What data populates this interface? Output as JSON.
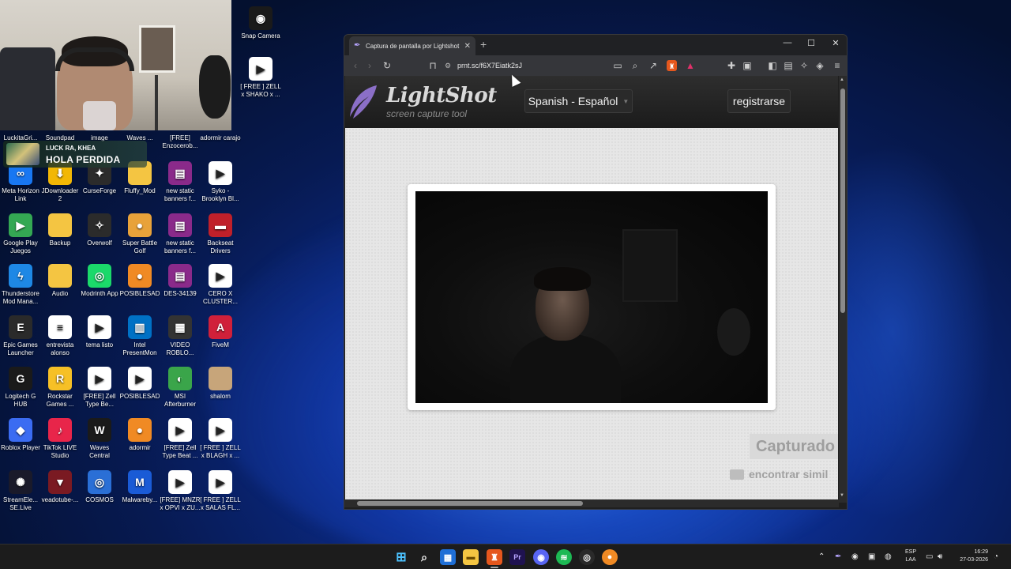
{
  "desktop": {
    "banner": {
      "artist": "LUCK RA, KHEA",
      "title": "HOLA PERDIDA"
    },
    "icons": [
      {
        "label": "Snap Camera",
        "glyph": "◉",
        "color": "#1a1a1a"
      },
      {
        "label": "[ FREE ] ZELL x SHAKO x ...",
        "glyph": "▶",
        "color": "#ffffff"
      },
      {
        "label": "LuckitaGri...",
        "glyph": "",
        "color": "#2b2b2b"
      },
      {
        "label": "Soundpad",
        "glyph": "",
        "color": "#2b2b2b"
      },
      {
        "label": "image",
        "glyph": "",
        "color": "#2b2b2b"
      },
      {
        "label": "Waves ...",
        "glyph": "",
        "color": "#2b2b2b"
      },
      {
        "label": "[FREE] Enzocerob...",
        "glyph": "",
        "color": "#2b2b2b"
      },
      {
        "label": "adormir carajo",
        "glyph": "",
        "color": "#2b2b2b"
      },
      {
        "label": "Meta Horizon Link",
        "glyph": "∞",
        "color": "#1877f2"
      },
      {
        "label": "JDownloader 2",
        "glyph": "⬇",
        "color": "#f2b705"
      },
      {
        "label": "CurseForge",
        "glyph": "✦",
        "color": "#2b2b2b"
      },
      {
        "label": "Fluffy_Mod",
        "glyph": "",
        "color": "#f4c542"
      },
      {
        "label": "new static banners f...",
        "glyph": "▤",
        "color": "#8a2a8a"
      },
      {
        "label": "Syko - Brooklyn Bl...",
        "glyph": "▶",
        "color": "#ffffff"
      },
      {
        "label": "Google Play Juegos",
        "glyph": "▶",
        "color": "#34a853"
      },
      {
        "label": "Backup",
        "glyph": "",
        "color": "#f4c542"
      },
      {
        "label": "Overwolf",
        "glyph": "✧",
        "color": "#2b2b2b"
      },
      {
        "label": "Super Battle Golf",
        "glyph": "●",
        "color": "#e8a23a"
      },
      {
        "label": "new static banners f...",
        "glyph": "▤",
        "color": "#8a2a8a"
      },
      {
        "label": "Backseat Drivers",
        "glyph": "▬",
        "color": "#c0202a"
      },
      {
        "label": "Thunderstore Mod Mana...",
        "glyph": "ϟ",
        "color": "#1e88e5"
      },
      {
        "label": "Audio",
        "glyph": "",
        "color": "#f4c542"
      },
      {
        "label": "Modrinth App",
        "glyph": "◎",
        "color": "#1bd96a"
      },
      {
        "label": "POSIBLESAD",
        "glyph": "●",
        "color": "#f08a24"
      },
      {
        "label": "DES-34139",
        "glyph": "▤",
        "color": "#8a2a8a"
      },
      {
        "label": "CERO X CLUSTER...",
        "glyph": "▶",
        "color": "#ffffff"
      },
      {
        "label": "Epic Games Launcher",
        "glyph": "E",
        "color": "#2a2a2a"
      },
      {
        "label": "entrevista alonso",
        "glyph": "≡",
        "color": "#ffffff"
      },
      {
        "label": "tema listo",
        "glyph": "▶",
        "color": "#ffffff"
      },
      {
        "label": "Intel PresentMon",
        "glyph": "▥",
        "color": "#0071c5"
      },
      {
        "label": "VIDEO ROBLO...",
        "glyph": "▦",
        "color": "#333333"
      },
      {
        "label": "FiveM",
        "glyph": "A",
        "color": "#d0203a"
      },
      {
        "label": "Logitech G HUB",
        "glyph": "G",
        "color": "#1a1a1a"
      },
      {
        "label": "Rockstar Games ...",
        "glyph": "R",
        "color": "#f6c026"
      },
      {
        "label": "[FREE] Zell Type Be...",
        "glyph": "▶",
        "color": "#ffffff"
      },
      {
        "label": "POSIBLESAD",
        "glyph": "▶",
        "color": "#ffffff"
      },
      {
        "label": "MSI Afterburner",
        "glyph": "◐",
        "color": "#3aa54a"
      },
      {
        "label": "shalom",
        "glyph": "",
        "color": "#c7a57a"
      },
      {
        "label": "Roblox Player",
        "glyph": "◆",
        "color": "#3b6cf2"
      },
      {
        "label": "TikTok LIVE Studio",
        "glyph": "♪",
        "color": "#e8254a"
      },
      {
        "label": "Waves Central",
        "glyph": "W",
        "color": "#1a1a1a"
      },
      {
        "label": "adormir",
        "glyph": "●",
        "color": "#f08a24"
      },
      {
        "label": "[FREE] Zell Type Beat ...",
        "glyph": "▶",
        "color": "#ffffff"
      },
      {
        "label": "[ FREE ] ZELL x BLAGH x ...",
        "glyph": "▶",
        "color": "#ffffff"
      },
      {
        "label": "StreamEle... SE.Live",
        "glyph": "✺",
        "color": "#1a1a2a"
      },
      {
        "label": "veadotube-...",
        "glyph": "▼",
        "color": "#7a1a22"
      },
      {
        "label": "COSMOS",
        "glyph": "◎",
        "color": "#2a6fd6"
      },
      {
        "label": "Malwareby...",
        "glyph": "M",
        "color": "#1a5bd6"
      },
      {
        "label": "[FREE] MNZR x OPVI x ZU...",
        "glyph": "▶",
        "color": "#ffffff"
      },
      {
        "label": "[ FREE ] ZELL x SALAS FL...",
        "glyph": "▶",
        "color": "#ffffff"
      }
    ]
  },
  "browser": {
    "tab_title": "Captura de pantalla por Lightshot",
    "url": "prnt.sc/f6X7Eiatk2sJ",
    "page": {
      "logo": "LightShot",
      "tagline": "screen capture tool",
      "language": "Spanish - Español",
      "register": "registrarse",
      "captured_by": "Capturado",
      "find_similar": "encontrar simil"
    }
  },
  "taskbar": {
    "lang_top": "ESP",
    "lang_bottom": "LAA",
    "time": "16:29",
    "date": "27-03-2026"
  }
}
